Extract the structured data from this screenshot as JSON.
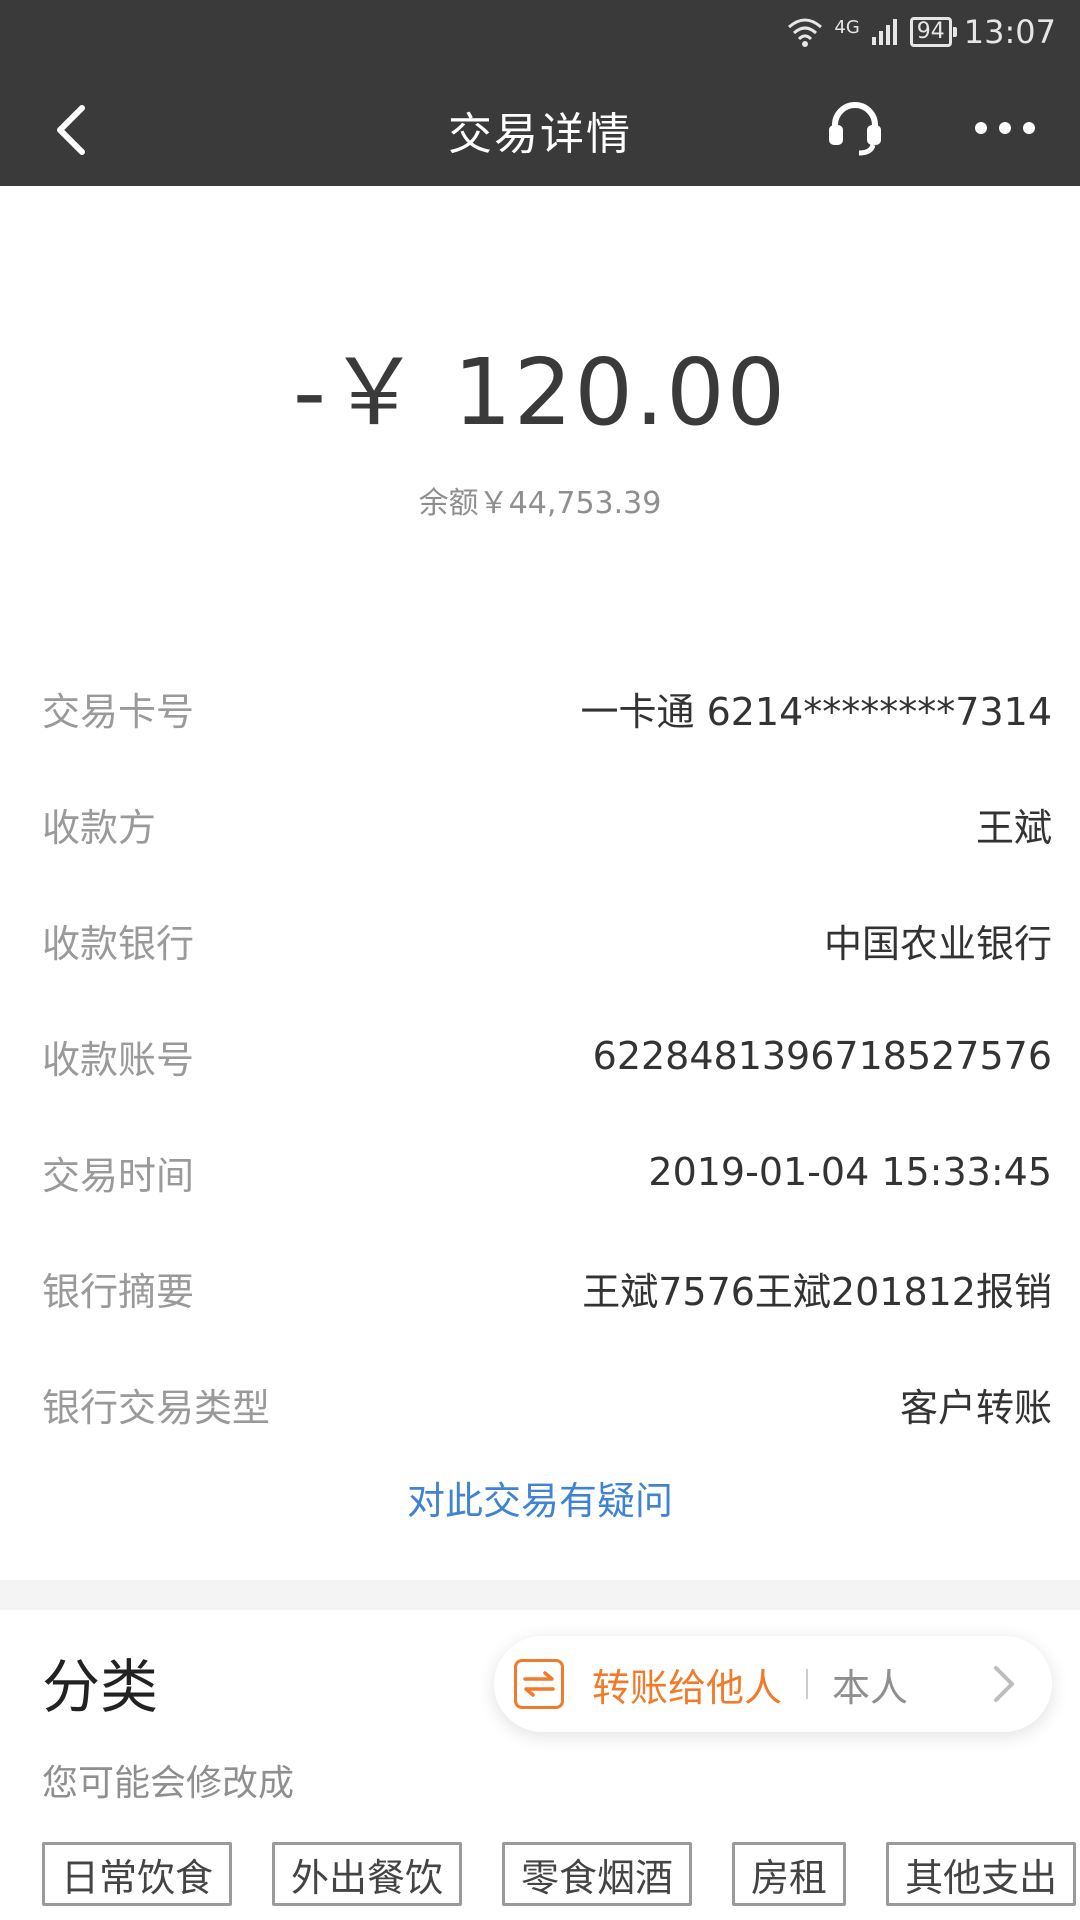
{
  "status": {
    "battery": "94",
    "network": "4G",
    "time": "13:07"
  },
  "header": {
    "title": "交易详情",
    "icons": [
      "back-icon",
      "headset-icon",
      "more-icon"
    ]
  },
  "summary": {
    "amount": "-￥ 120.00",
    "balance": "余额￥44,753.39"
  },
  "details": [
    {
      "label": "交易卡号",
      "value": "一卡通 6214********7314"
    },
    {
      "label": "收款方",
      "value": "王斌"
    },
    {
      "label": "收款银行",
      "value": "中国农业银行"
    },
    {
      "label": "收款账号",
      "value": "6228481396718527576"
    },
    {
      "label": "交易时间",
      "value": "2019-01-04 15:33:45"
    },
    {
      "label": "银行摘要",
      "value": "王斌7576王斌201812报销"
    },
    {
      "label": "银行交易类型",
      "value": "客户转账"
    }
  ],
  "question_link": "对此交易有疑问",
  "category": {
    "title": "分类",
    "hint": "您可能会修改成",
    "transfer_main": "转账给他人",
    "transfer_sub": "本人",
    "tags": [
      "日常饮食",
      "外出餐饮",
      "零食烟酒",
      "房租",
      "其他支出"
    ]
  },
  "colors": {
    "header_bg": "#3a3a3a",
    "link": "#3f83d1",
    "accent": "#f07b2b"
  }
}
